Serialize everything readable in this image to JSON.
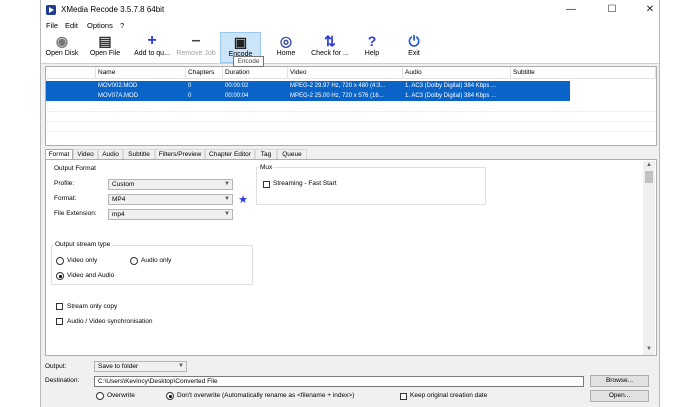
{
  "window": {
    "title": "XMedia Recode 3.5.7.8 64bit"
  },
  "menu": [
    "File",
    "Edit",
    "Options",
    "?"
  ],
  "toolbar": {
    "open_disk": "Open Disk",
    "open_file": "Open File",
    "add_to_queue": "Add to qu...",
    "remove_job": "Remove Job",
    "encode": "Encode",
    "home": "Home",
    "check_for": "Check for ...",
    "help": "Help",
    "exit": "Exit",
    "tooltip": "Encode"
  },
  "filelist": {
    "columns": [
      "Name",
      "Chapters",
      "Duration",
      "Video",
      "Audio",
      "Subtitle"
    ],
    "rows": [
      [
        "MOV002.MOD",
        "0",
        "00:00:02",
        "MPEG-2 29.97 Hz, 720 x 480 (4:3...",
        "1. AC3 (Dolby Digital) 384 Kbps ...",
        ""
      ],
      [
        "MOV07A.MOD",
        "0",
        "00:00:04",
        "MPEG-2 25.00 Hz, 720 x 576 (16...",
        "1. AC3 (Dolby Digital) 384 Kbps ...",
        ""
      ]
    ]
  },
  "tabs": [
    "Format",
    "Video",
    "Audio",
    "Subtitle",
    "Filters/Preview",
    "Chapter Editor",
    "Tag",
    "Queue"
  ],
  "format": {
    "output_format_label": "Output Format",
    "profile_label": "Profile:",
    "profile_value": "Custom",
    "format_label": "Format:",
    "format_value": "MP4",
    "extension_label": "File Extension:",
    "extension_value": "mp4",
    "mux_label": "Mux",
    "streaming_label": "Streaming - Fast Start",
    "output_stream_label": "Output stream type",
    "video_only": "Video only",
    "audio_only": "Audio only",
    "video_and_audio": "Video and Audio",
    "stream_only_copy": "Stream only copy",
    "av_sync": "Audio / Video synchronisation"
  },
  "bottom": {
    "output_label": "Output:",
    "output_value": "Save to folder",
    "destination_label": "Destination:",
    "destination_value": "C:\\Users\\Kevincy\\Desktop\\Converted File",
    "browse": "Browse...",
    "open": "Open...",
    "overwrite": "Overwrite",
    "dont_overwrite": "Don't overwrite (Automatically rename as <filename + index>)",
    "keep_date": "Keep original creation date"
  },
  "colors": {
    "selection": "#0a64c8",
    "accent": "#2d3bd9",
    "exit_icon": "#1f56d6"
  }
}
